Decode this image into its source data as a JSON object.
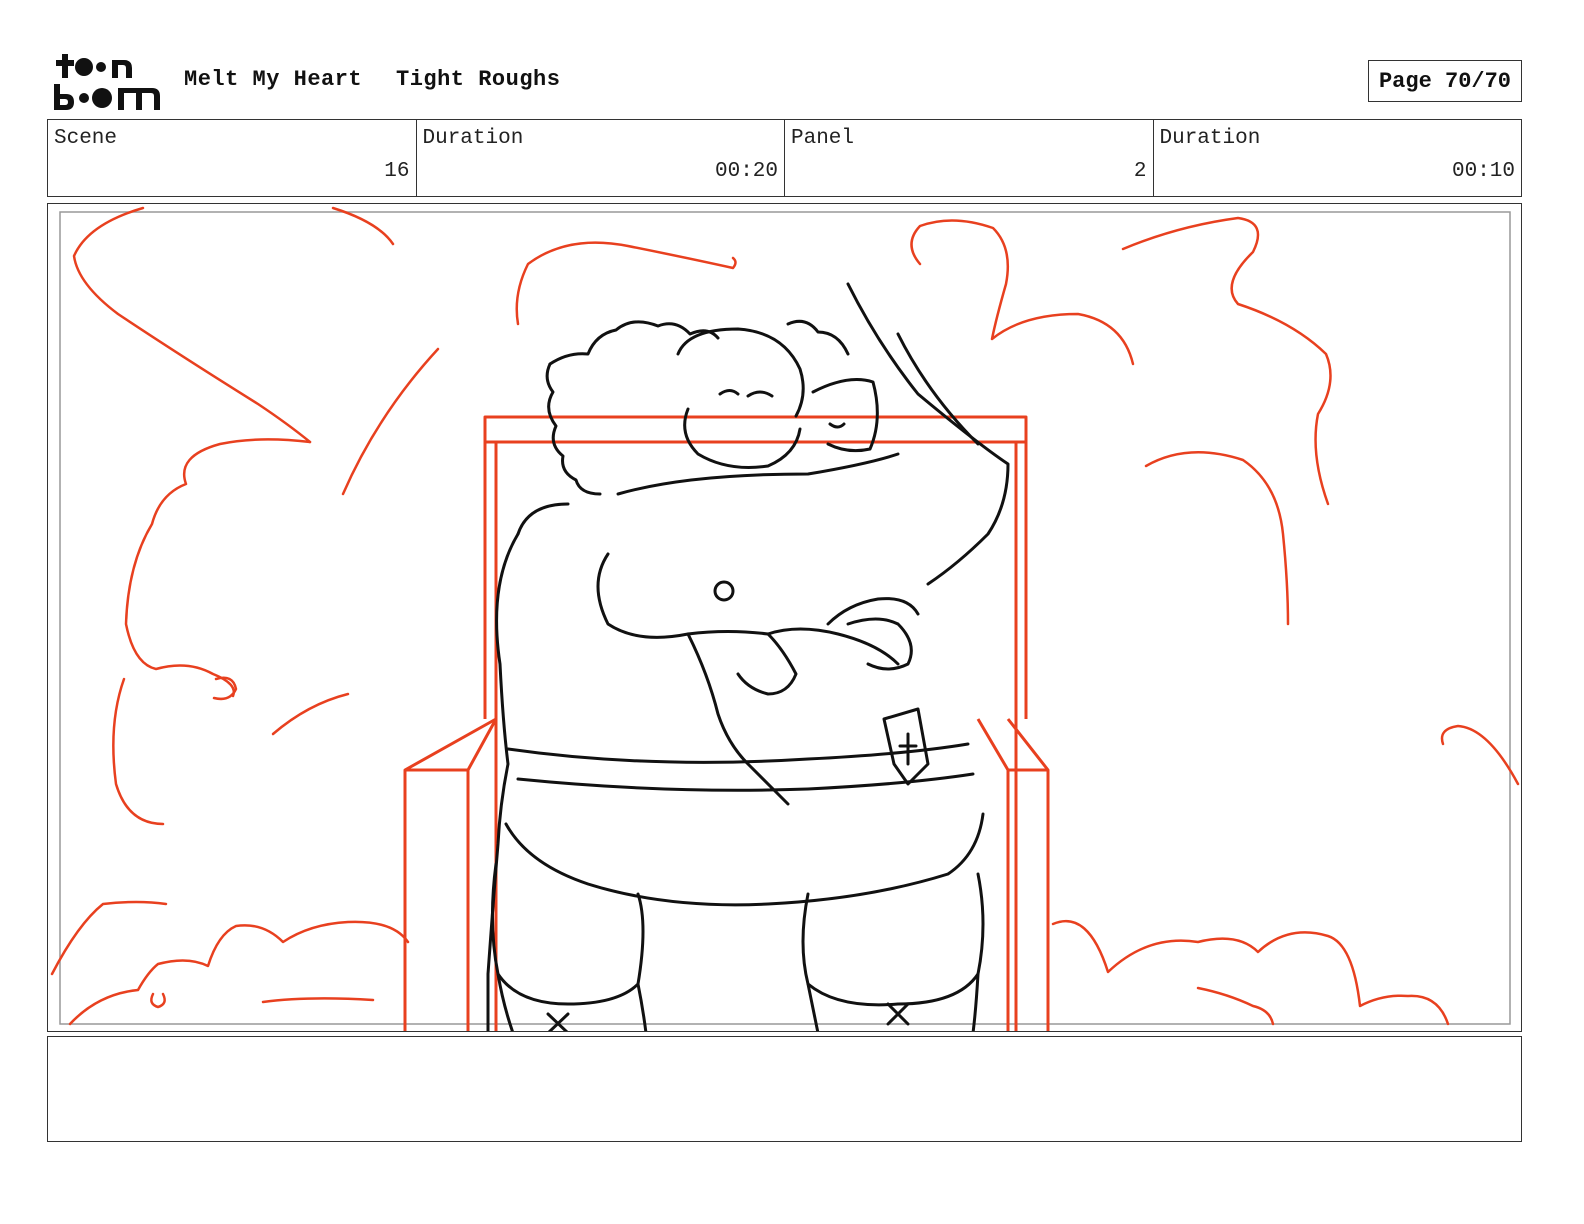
{
  "header": {
    "logo_name": "toonboom",
    "project_title": "Melt My Heart",
    "section_title": "Tight Roughs",
    "page_label": "Page 70/70"
  },
  "info": {
    "scene_label": "Scene",
    "scene_value": "16",
    "scene_duration_label": "Duration",
    "scene_duration_value": "00:20",
    "panel_label": "Panel",
    "panel_value": "2",
    "panel_duration_label": "Duration",
    "panel_duration_value": "00:10"
  },
  "notes": {
    "text": ""
  },
  "colors": {
    "sketch_red": "#e8401f",
    "line_black": "#111111",
    "frame_gray": "#333333"
  }
}
